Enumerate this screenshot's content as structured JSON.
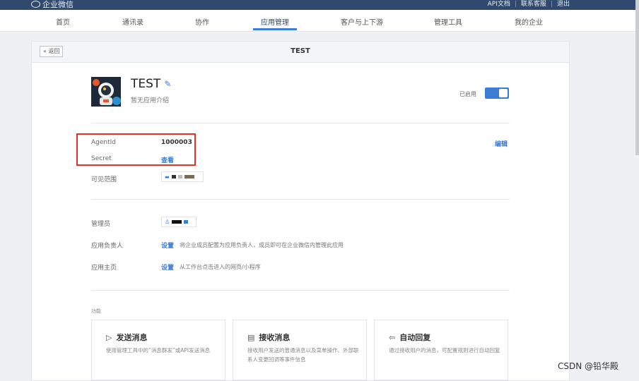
{
  "topbar": {
    "logo_text": "企业微信",
    "links": [
      "API文档",
      "联系客服",
      "退出"
    ]
  },
  "nav": {
    "items": [
      "首页",
      "通讯录",
      "协作",
      "应用管理",
      "客户与上下游",
      "管理工具",
      "我的企业"
    ],
    "active_index": 3
  },
  "page": {
    "back_label": "« 返回",
    "title": "TEST"
  },
  "app": {
    "name": "TEST",
    "description": "暂无应用介绍",
    "status_label": "已启用",
    "enabled": true
  },
  "details": {
    "agentid_label": "AgentId",
    "agentid_value": "1000003",
    "secret_label": "Secret",
    "secret_action": "查看",
    "visibility_label": "可见范围",
    "edit_label": "编辑"
  },
  "admin": {
    "admins_label": "管理员",
    "owner_label": "应用负责人",
    "owner_action": "设置",
    "owner_hint": "将企业成员配置为应用负责人，成员即可在企业微信内管理此应用",
    "homepage_label": "应用主页",
    "homepage_action": "设置",
    "homepage_hint": "从工作台点击进入的网页/小程序"
  },
  "features": {
    "section_label": "功能",
    "cards": [
      {
        "icon": "send-icon",
        "title": "发送消息",
        "desc": "使用管理工具中的“消息群发”或API发送消息"
      },
      {
        "icon": "chat-icon",
        "title": "接收消息",
        "desc": "接收用户发送的普通消息以及菜单操作、外部联系人变更回调等事件信息"
      },
      {
        "icon": "reply-icon",
        "title": "自动回复",
        "desc": "通过接收用户的消息，可配置规则进行自动回复"
      }
    ]
  },
  "watermark": "CSDN @铅华殿",
  "colors": {
    "topbar": "#2f4a6e",
    "accent": "#3b7cd6",
    "highlight": "#e0312a"
  }
}
